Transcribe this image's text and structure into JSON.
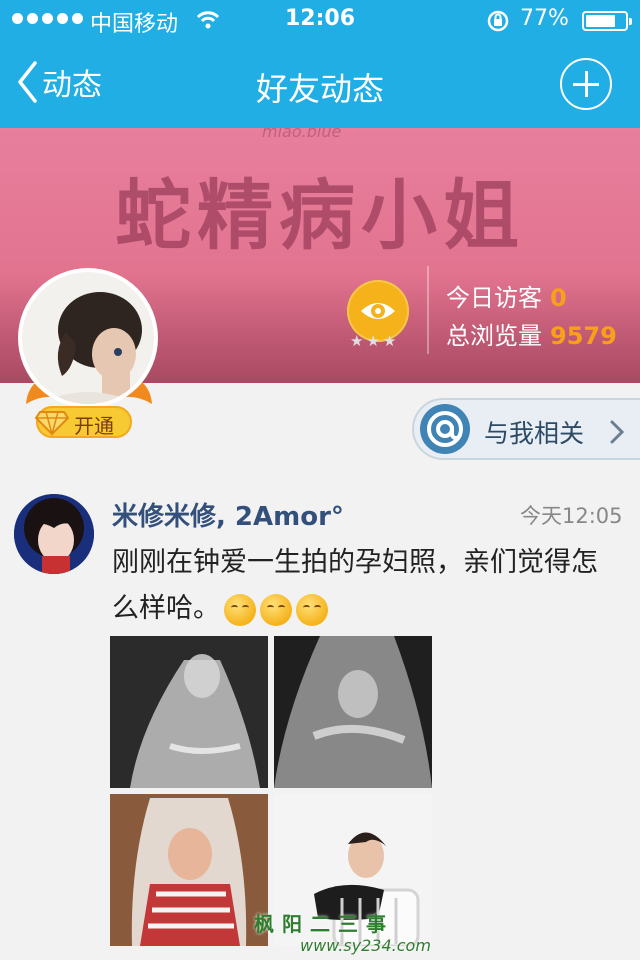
{
  "status_bar": {
    "carrier": "中国移动",
    "time": "12:06",
    "battery": "77%",
    "battery_level": 0.77
  },
  "nav": {
    "back_label": "动态",
    "title": "好友动态"
  },
  "cover": {
    "watermark": "miao.blue",
    "title": "蛇精病小姐"
  },
  "visitors": {
    "stars": "★★★",
    "today_label": "今日访客",
    "today_value": "0",
    "total_label": "总浏览量",
    "total_value": "9579"
  },
  "vip": {
    "label": "开通"
  },
  "related": {
    "label": "与我相关"
  },
  "feed": {
    "author": "米修米修, 2Amor°",
    "time": "今天12:05",
    "text": "刚刚在钟爱一生拍的孕妇照，亲们觉得怎么样哈。",
    "photo_count": 4
  },
  "footer": {
    "watermark": "枫阳二三事",
    "site": "www.sy234.com"
  },
  "colors": {
    "nav_bg": "#21aee5",
    "cover_pink": "#e27490",
    "accent_orange": "#f8a01a",
    "link_blue": "#334f7c"
  },
  "icons": {
    "back": "chevron-left-icon",
    "add": "plus-circle-icon",
    "eye": "eye-icon",
    "at": "at-icon",
    "chevron": "chevron-right-icon",
    "vip": "diamond-icon",
    "emoji": "smile-emoji-icon"
  }
}
